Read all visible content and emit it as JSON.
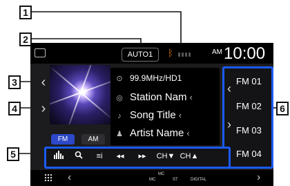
{
  "callouts": {
    "c1": "1",
    "c2": "2",
    "c3": "3",
    "c4": "4",
    "c5": "5",
    "c6": "6"
  },
  "status_bar": {
    "mode_badge": "AUTO1",
    "ampm": "AM",
    "clock": "10:00",
    "bluetooth_icon": "bluetooth-icon",
    "signal_icon": "signal-bars-icon"
  },
  "station_info": {
    "frequency": "99.9MHz/HD1",
    "station_name": "Station Nam",
    "song_title": "Song Title",
    "artist_name": "Artist Name"
  },
  "bands": {
    "fm": "FM",
    "am": "AM"
  },
  "presets": [
    "FM 01",
    "FM 02",
    "FM 03",
    "FM 04"
  ],
  "controls": {
    "info_label": "≡i",
    "ch_down": "CH▼",
    "ch_up": "CH▲"
  },
  "bottom_bar": {
    "mc_top": "MC",
    "mc": "MC",
    "st": "ST",
    "digital": "DIGITAL"
  },
  "colors": {
    "accent_blue": "#1b5bff",
    "fm_button": "#2c48c8",
    "bluetooth_orange": "#e07b1a"
  }
}
